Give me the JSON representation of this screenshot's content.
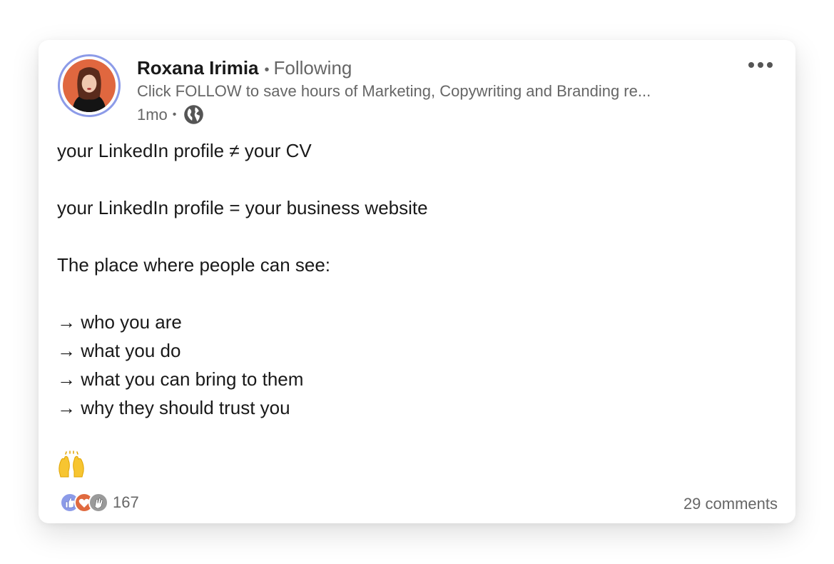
{
  "post": {
    "author": {
      "name": "Roxana Irimia",
      "relation": "Following",
      "separator": "•",
      "tagline": "Click FOLLOW to save hours of Marketing, Copywriting and Branding re...",
      "timestamp": "1mo",
      "visibility_icon": "globe-icon",
      "avatar_ring_color": "#8c9be8"
    },
    "menu_icon": "more-horizontal-icon",
    "body_lines": [
      "your LinkedIn profile ≠ your CV",
      "",
      "your LinkedIn profile = your business website",
      "",
      "The place where people can see:",
      "",
      "→ who you are",
      "→ what you do",
      "→ what you can bring to them",
      "→ why they should trust you"
    ],
    "emoji_icon": "raising-hands-icon",
    "reactions": {
      "icons": [
        "like-icon",
        "love-icon",
        "celebrate-icon"
      ],
      "count": "167"
    },
    "comments_label": "29 comments"
  }
}
